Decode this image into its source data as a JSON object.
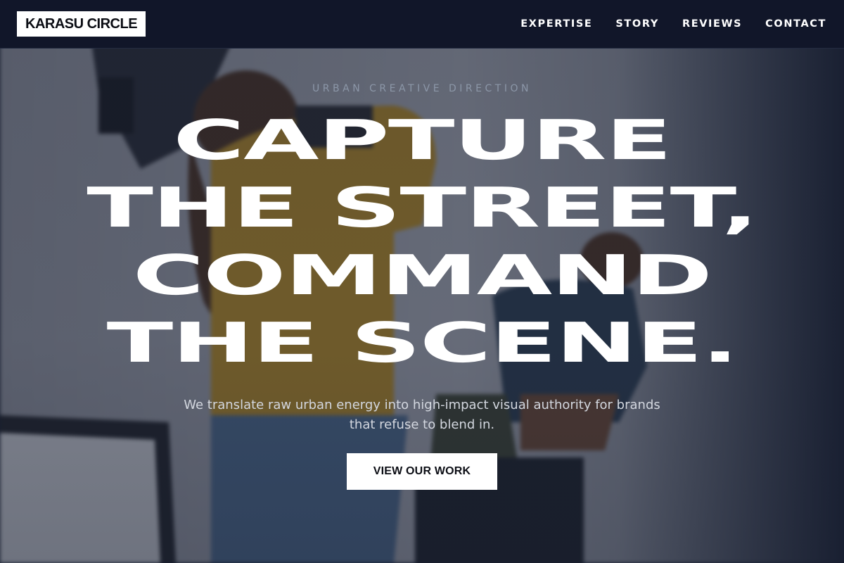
{
  "brand": {
    "logo_text": "KARASU CIRCLE"
  },
  "nav": {
    "links": [
      {
        "label": "EXPERTISE"
      },
      {
        "label": "STORY"
      },
      {
        "label": "REVIEWS"
      },
      {
        "label": "CONTACT"
      }
    ]
  },
  "hero": {
    "eyebrow": "URBAN CREATIVE DIRECTION",
    "headline_lines": [
      "CAPTURE",
      "THE STREET,",
      "COMMAND",
      "THE SCENE."
    ],
    "subtitle": "We translate raw urban energy into high-impact visual authority for brands that refuse to blend in.",
    "cta_label": "VIEW OUR WORK"
  },
  "colors": {
    "nav_background": "#111629",
    "logo_background": "#ffffff",
    "headline_text": "#ffffff",
    "cta_background": "#ffffff",
    "cta_text": "#0b0d14"
  }
}
